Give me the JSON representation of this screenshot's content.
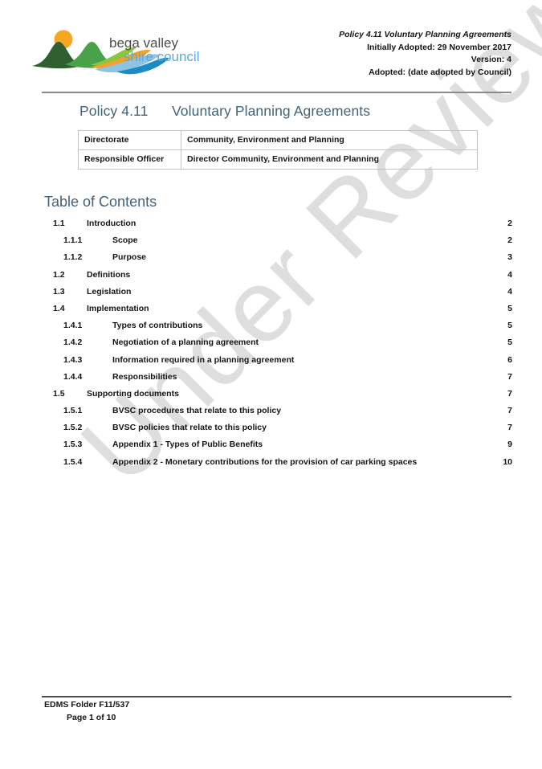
{
  "header": {
    "logo_alt": "bega valley shire council",
    "logo_line1": "bega valley",
    "logo_line2": "shire council",
    "meta_line1": "Policy 4.11 Voluntary Planning Agreements",
    "meta_line2": "Initially Adopted: 29 November 2017",
    "meta_line3": "Version: 4",
    "meta_line4": "Adopted: (date adopted by Council)"
  },
  "title": {
    "number": "Policy 4.11",
    "text": "Voluntary Planning Agreements"
  },
  "info_table": {
    "rows": [
      {
        "label": "Directorate",
        "value": "Community, Environment and Planning"
      },
      {
        "label": "Responsible Officer",
        "value": "Director Community, Environment and Planning"
      }
    ]
  },
  "toc": {
    "heading": "Table of Contents",
    "entries": [
      {
        "level": 1,
        "number": "1.1",
        "title": "Introduction",
        "page": "2"
      },
      {
        "level": 2,
        "number": "1.1.1",
        "title": "Scope",
        "page": "2"
      },
      {
        "level": 2,
        "number": "1.1.2",
        "title": "Purpose",
        "page": "3"
      },
      {
        "level": 1,
        "number": "1.2",
        "title": "Definitions",
        "page": "4"
      },
      {
        "level": 1,
        "number": "1.3",
        "title": "Legislation",
        "page": "4"
      },
      {
        "level": 1,
        "number": "1.4",
        "title": "Implementation",
        "page": "5"
      },
      {
        "level": 2,
        "number": "1.4.1",
        "title": "Types of contributions",
        "page": "5"
      },
      {
        "level": 2,
        "number": "1.4.2",
        "title": "Negotiation of a planning agreement",
        "page": "5"
      },
      {
        "level": 2,
        "number": "1.4.3",
        "title": "Information required in a planning agreement",
        "page": "6"
      },
      {
        "level": 2,
        "number": "1.4.4",
        "title": "Responsibilities",
        "page": "7"
      },
      {
        "level": 1,
        "number": "1.5",
        "title": "Supporting documents",
        "page": "7"
      },
      {
        "level": 2,
        "number": "1.5.1",
        "title": "BVSC procedures that relate to this policy",
        "page": "7"
      },
      {
        "level": 2,
        "number": "1.5.2",
        "title": "BVSC policies that relate to this policy",
        "page": "7"
      },
      {
        "level": 2,
        "number": "1.5.3",
        "title": "Appendix 1 - Types of Public Benefits",
        "page": "9"
      },
      {
        "level": 2,
        "number": "1.5.4",
        "title": "Appendix 2 - Monetary contributions for the provision of car parking spaces",
        "page": "10"
      }
    ]
  },
  "watermark": {
    "text": "Under Review"
  },
  "footer": {
    "edms": "EDMS Folder F11/537",
    "page_prefix": "Page ",
    "page_current": "1",
    "page_middle": " of ",
    "page_total": "10"
  },
  "colors": {
    "title_blue": "#41637a",
    "logo_sun": "#f5a623",
    "logo_dark_green": "#3a6b35",
    "logo_mid_green": "#4fa247",
    "logo_light_green": "#8cc63f",
    "logo_orange": "#f0a22e",
    "logo_light_blue": "#8fc3e3",
    "logo_blue": "#1b8cc4",
    "logo_text_dark": "#4d4d4d",
    "watermark": "#dededf",
    "rule": "#8a8a8a",
    "table_border": "#c3c3c3"
  }
}
